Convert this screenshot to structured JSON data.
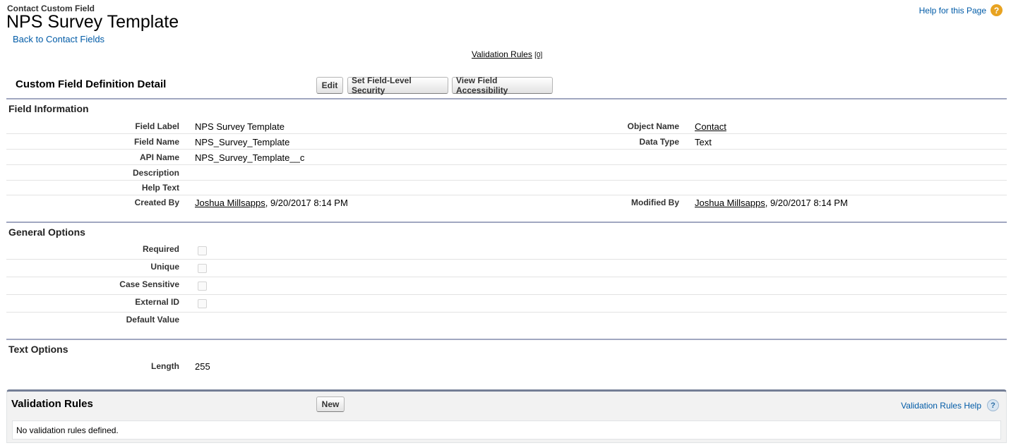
{
  "header": {
    "object_type": "Contact Custom Field",
    "title": "NPS Survey Template",
    "back_link": "Back to Contact Fields",
    "help_link": "Help for this Page",
    "help_icon": "?"
  },
  "related_links": {
    "validation_rules_label": "Validation Rules",
    "validation_rules_count": "[0]"
  },
  "detail": {
    "title": "Custom Field Definition Detail",
    "buttons": {
      "edit": "Edit",
      "field_level_security": "Set Field-Level Security",
      "view_accessibility": "View Field Accessibility"
    }
  },
  "field_information": {
    "section_title": "Field Information",
    "field_label_label": "Field Label",
    "field_label_value": "NPS Survey Template",
    "object_name_label": "Object Name",
    "object_name_value": "Contact",
    "field_name_label": "Field Name",
    "field_name_value": "NPS_Survey_Template",
    "data_type_label": "Data Type",
    "data_type_value": "Text",
    "api_name_label": "API Name",
    "api_name_value": "NPS_Survey_Template__c",
    "description_label": "Description",
    "help_text_label": "Help Text",
    "created_by_label": "Created By",
    "created_by_user": "Joshua Millsapps",
    "created_by_date": ", 9/20/2017 8:14 PM",
    "modified_by_label": "Modified By",
    "modified_by_user": "Joshua Millsapps",
    "modified_by_date": ", 9/20/2017 8:14 PM"
  },
  "general_options": {
    "section_title": "General Options",
    "required_label": "Required",
    "unique_label": "Unique",
    "case_sensitive_label": "Case Sensitive",
    "external_id_label": "External ID",
    "default_value_label": "Default Value"
  },
  "text_options": {
    "section_title": "Text Options",
    "length_label": "Length",
    "length_value": "255"
  },
  "validation_rules": {
    "title": "Validation Rules",
    "new_button": "New",
    "help_link": "Validation Rules Help",
    "help_icon": "?",
    "empty_message": "No validation rules defined."
  }
}
